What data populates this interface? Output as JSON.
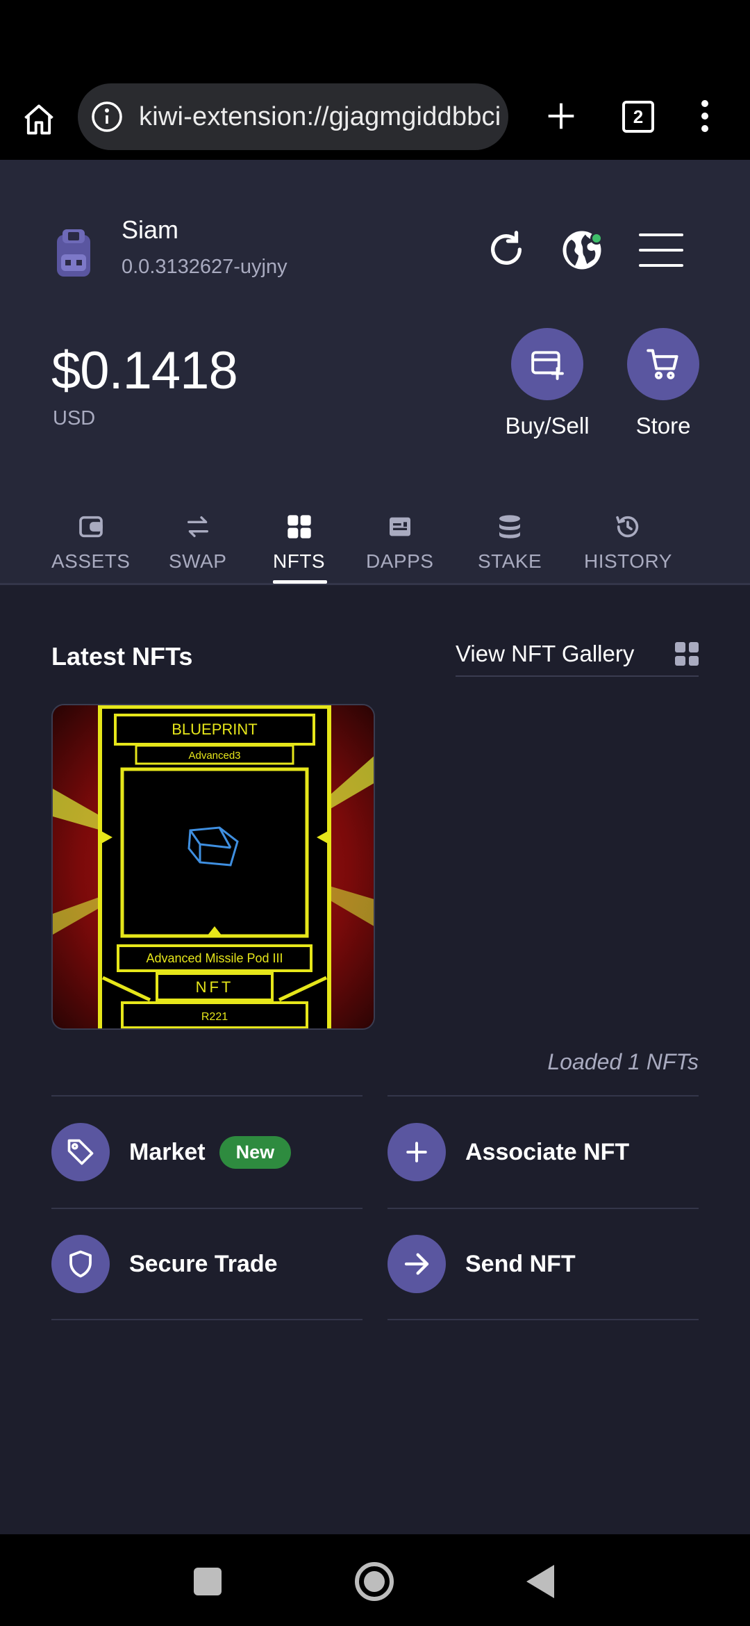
{
  "browser": {
    "url": "kiwi-extension://gjagmgiddbbci",
    "tab_count": "2"
  },
  "account": {
    "name": "Siam",
    "id": "0.0.3132627-uyjny"
  },
  "balance": {
    "amount": "$0.1418",
    "currency": "USD"
  },
  "actions": {
    "buy_sell": "Buy/Sell",
    "store": "Store"
  },
  "tabs": [
    {
      "label": "ASSETS",
      "icon": "wallet-icon"
    },
    {
      "label": "SWAP",
      "icon": "swap-icon"
    },
    {
      "label": "NFTS",
      "icon": "grid-icon",
      "active": true
    },
    {
      "label": "DAPPS",
      "icon": "dapps-icon"
    },
    {
      "label": "STAKE",
      "icon": "stack-icon"
    },
    {
      "label": "HISTORY",
      "icon": "history-icon"
    }
  ],
  "main": {
    "section_title": "Latest NFTs",
    "gallery_link": "View NFT Gallery",
    "loaded_text": "Loaded 1 NFTs"
  },
  "nft": {
    "header": "BLUEPRINT",
    "subheader": "Advanced3",
    "name": "Advanced Missile Pod III",
    "type": "NFT",
    "rarity": "R221"
  },
  "nft_actions": {
    "market": "Market",
    "market_badge": "New",
    "associate": "Associate NFT",
    "secure_trade": "Secure Trade",
    "send": "Send NFT"
  },
  "colors": {
    "background": "#1d1e2c",
    "header_bg": "#262839",
    "accent": "#5a56a0",
    "badge_green": "#2e8b3f",
    "muted_text": "#a9abc0",
    "nft_frame_yellow": "#e6e61a",
    "nft_bg_red": "#8a0c0c"
  }
}
